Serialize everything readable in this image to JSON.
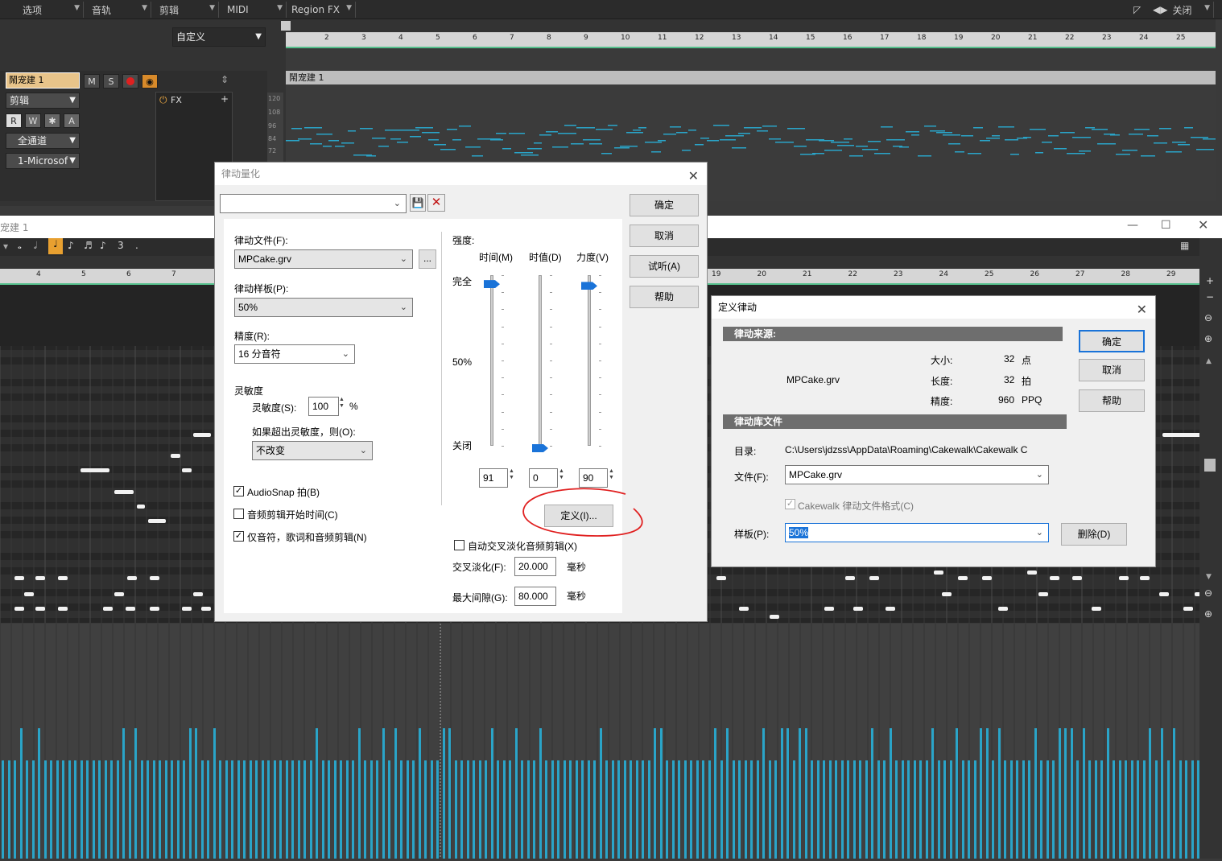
{
  "topbar": {
    "menus": [
      "选项",
      "音轨",
      "剪辑",
      "MIDI",
      "Region FX"
    ],
    "close_label": "关闭"
  },
  "track": {
    "preset": "自定义",
    "name": "鬧宠建 1",
    "m": "M",
    "s": "S",
    "mode": "剪辑",
    "r": "R",
    "w": "W",
    "a": "A",
    "channel": "全通道",
    "input": "1-Microsof",
    "fx": "FX",
    "clip_name": "鬧宠建 1",
    "scale_labels": [
      "120",
      "108",
      "96",
      "84",
      "72"
    ]
  },
  "ruler_top": [
    "2",
    "3",
    "4",
    "5",
    "6",
    "7",
    "8",
    "9",
    "10",
    "11",
    "12",
    "13",
    "14",
    "15",
    "16",
    "17",
    "18",
    "19",
    "20",
    "21",
    "22",
    "23",
    "24",
    "25"
  ],
  "pianoroll": {
    "title": "宠建 1",
    "ruler_left": [
      "4",
      "5",
      "6",
      "7"
    ],
    "ruler_right": [
      "19",
      "20",
      "21",
      "22",
      "23",
      "24",
      "25",
      "26",
      "27",
      "28",
      "29"
    ],
    "triplet": "3",
    "dot": "."
  },
  "groove": {
    "title": "律动量化",
    "ok": "确定",
    "cancel": "取消",
    "audition": "试听(A)",
    "help": "帮助",
    "groove_file_label": "律动文件(F):",
    "groove_file": "MPCake.grv",
    "browse": "...",
    "groove_pattern_label": "律动样板(P):",
    "groove_pattern": "50%",
    "resolution_label": "精度(R):",
    "resolution": "16 分音符",
    "sensitivity_group": "灵敏度",
    "sensitivity_label": "灵敏度(S):",
    "sensitivity": "100",
    "percent": "%",
    "outside_label": "如果超出灵敏度，则(O):",
    "outside": "不改变",
    "audiosnap": "AudioSnap 拍(B)",
    "audio_start": "音频剪辑开始时间(C)",
    "notes_only": "仅音符，歌词和音频剪辑(N)",
    "strength_label": "强度:",
    "time_label": "时间(M)",
    "duration_label": "时值(D)",
    "velocity_label": "力度(V)",
    "full": "完全",
    "half": "50%",
    "off": "关闭",
    "time_value": "91",
    "duration_value": "0",
    "velocity_value": "90",
    "time_level": 0.91,
    "duration_level": 0,
    "velocity_level": 0.9,
    "define": "定义(I)...",
    "auto_crossfade": "自动交叉淡化音频剪辑(X)",
    "crossfade_label": "交叉淡化(F):",
    "crossfade": "20.000",
    "ms1": "毫秒",
    "maxgap_label": "最大间隙(G):",
    "maxgap": "80.000",
    "ms2": "毫秒"
  },
  "define": {
    "title": "定义律动",
    "ok": "确定",
    "cancel": "取消",
    "help": "帮助",
    "source_header": "律动来源:",
    "source_file": "MPCake.grv",
    "size_label": "大小:",
    "size_value": "32",
    "size_unit": "点",
    "length_label": "长度:",
    "length_value": "32",
    "length_unit": "拍",
    "res_label": "精度:",
    "res_value": "960",
    "res_unit": "PPQ",
    "lib_header": "律动库文件",
    "dir_label": "目录:",
    "dir": "C:\\Users\\jdzss\\AppData\\Roaming\\Cakewalk\\Cakewalk C",
    "file_label": "文件(F):",
    "file": "MPCake.grv",
    "format": "Cakewalk 律动文件格式(C)",
    "pattern_label": "样板(P):",
    "pattern": "50%",
    "delete": "删除(D)"
  },
  "colors": {
    "accent": "#1a73d8",
    "midi": "#2aa4c8",
    "annotation": "#e02020"
  }
}
